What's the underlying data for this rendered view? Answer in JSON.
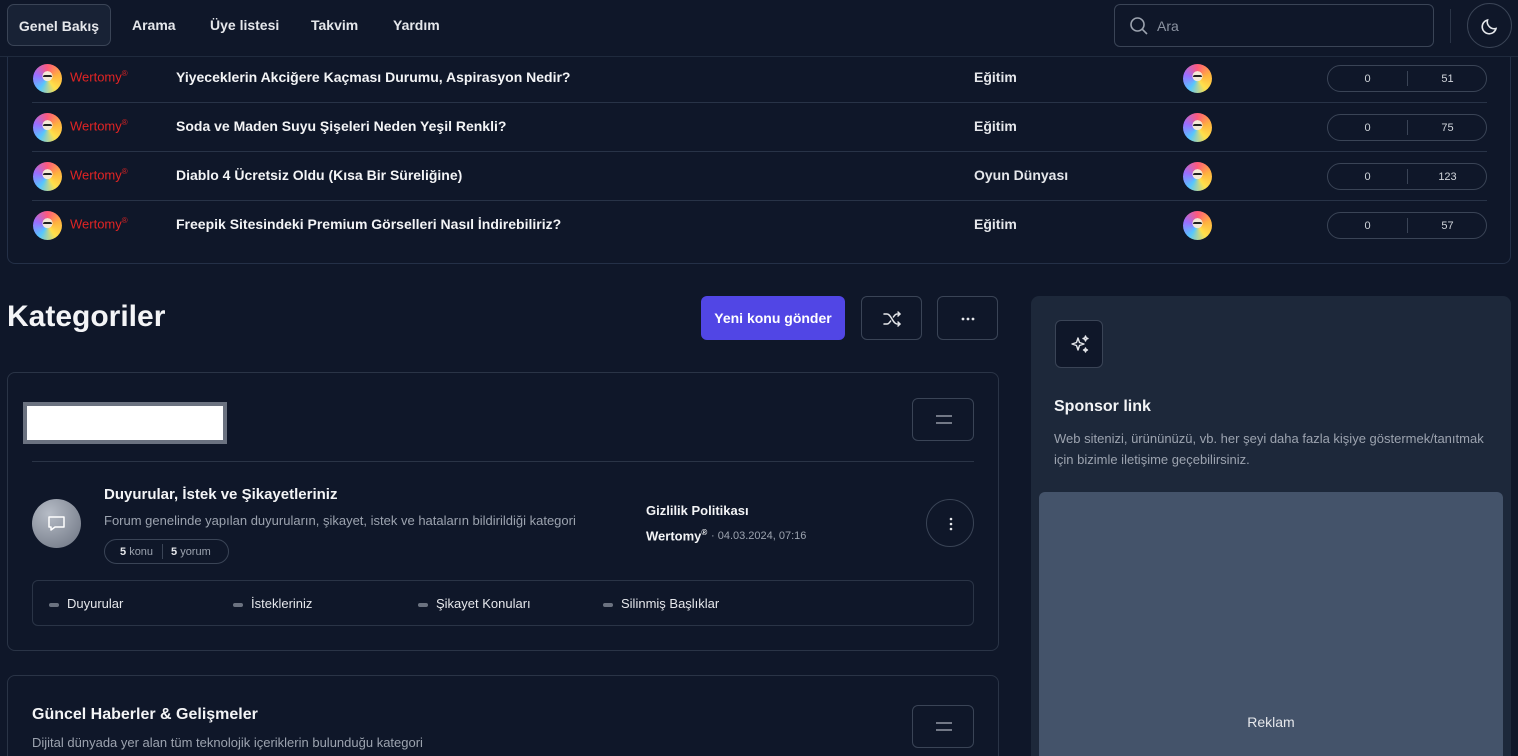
{
  "nav": {
    "items": [
      "Genel Bakış",
      "Arama",
      "Üye listesi",
      "Takvim",
      "Yardım"
    ],
    "search_placeholder": "Ara"
  },
  "topics": [
    {
      "user": "Wertomy",
      "user_mark": "®",
      "title": "Yiyeceklerin Akciğere Kaçması Durumu, Aspirasyon Nedir?",
      "category": "Eğitim",
      "replies": "0",
      "views": "51"
    },
    {
      "user": "Wertomy",
      "user_mark": "®",
      "title": "Soda ve Maden Suyu Şişeleri Neden Yeşil Renkli?",
      "category": "Eğitim",
      "replies": "0",
      "views": "75"
    },
    {
      "user": "Wertomy",
      "user_mark": "®",
      "title": "Diablo 4 Ücretsiz Oldu (Kısa Bir Süreliğine)",
      "category": "Oyun Dünyası",
      "replies": "0",
      "views": "123"
    },
    {
      "user": "Wertomy",
      "user_mark": "®",
      "title": "Freepik Sitesindeki Premium Görselleri Nasıl İndirebiliriz?",
      "category": "Eğitim",
      "replies": "0",
      "views": "57"
    }
  ],
  "main": {
    "heading": "Kategoriler",
    "new_topic": "Yeni konu gönder"
  },
  "forum": {
    "title": "Duyurular, İstek ve Şikayetleriniz",
    "description": "Forum genelinde yapılan duyuruların, şikayet, istek ve hataların bildirildiği kategori",
    "topics_count": "5",
    "topics_label": "konu",
    "posts_count": "5",
    "posts_label": "yorum",
    "last_title": "Gizlilik Politikası",
    "last_user": "Wertomy",
    "last_user_mark": "®",
    "last_date": "· 04.03.2024, 07:16",
    "subforums": [
      "Duyurular",
      "İstekleriniz",
      "Şikayet Konuları",
      "Silinmiş Başlıklar"
    ]
  },
  "category2": {
    "title": "Güncel Haberler & Gelişmeler",
    "description": "Dijital dünyada yer alan tüm teknolojik içeriklerin bulunduğu kategori"
  },
  "sidebar": {
    "title": "Sponsor link",
    "description": "Web sitenizi, ürününüzü, vb. her şeyi daha fazla kişiye göstermek/tanıtmak için bizimle iletişime geçebilirsiniz.",
    "ad_label": "Reklam"
  },
  "colors": {
    "background": "#0f1729",
    "accent": "#5146e5",
    "username": "#e02424",
    "sidebar": "#1d283a"
  },
  "icons": [
    "search-icon",
    "moon-icon",
    "shuffle-icon",
    "more-horizontal-icon",
    "menu-lines-icon",
    "chat-bubble-icon",
    "more-vertical-icon",
    "sparkles-icon"
  ]
}
